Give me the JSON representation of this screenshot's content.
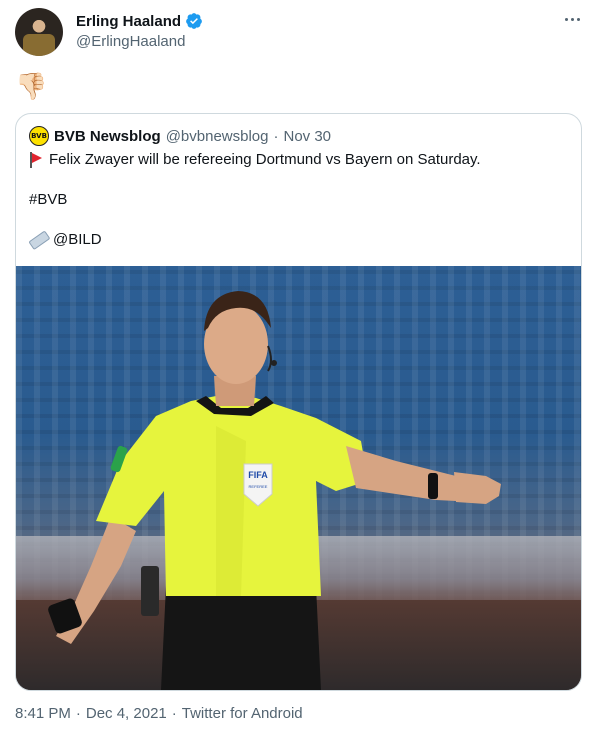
{
  "author": {
    "name": "Erling Haaland",
    "handle": "@ErlingHaaland",
    "verified": true,
    "verified_icon": "verified-badge-icon"
  },
  "more_icon": "more-options-icon",
  "tweet": {
    "text": "👎🏻"
  },
  "quoted": {
    "name": "BVB Newsblog",
    "avatar_text": "BVB",
    "handle": "@bvbnewsblog",
    "separator": "·",
    "date": "Nov 30",
    "line1": "Felix Zwayer will be refereeing Dortmund vs Bayern on Saturday.",
    "line2": "#BVB",
    "line3": "@BILD",
    "line1_icon": "red-flag-icon",
    "line3_icon": "rolled-newspaper-icon",
    "image_alt": "Referee in yellow shirt pointing",
    "badge_text": "FIFA",
    "badge_sub": "REFEREE"
  },
  "footer": {
    "time": "8:41 PM",
    "separator": "·",
    "date": "Dec 4, 2021",
    "source": "Twitter for Android"
  },
  "colors": {
    "text": "#0f1419",
    "muted": "#536471",
    "border": "#cfd9de",
    "verified_blue": "#1d9bf0",
    "shirt": "#e8f547"
  }
}
